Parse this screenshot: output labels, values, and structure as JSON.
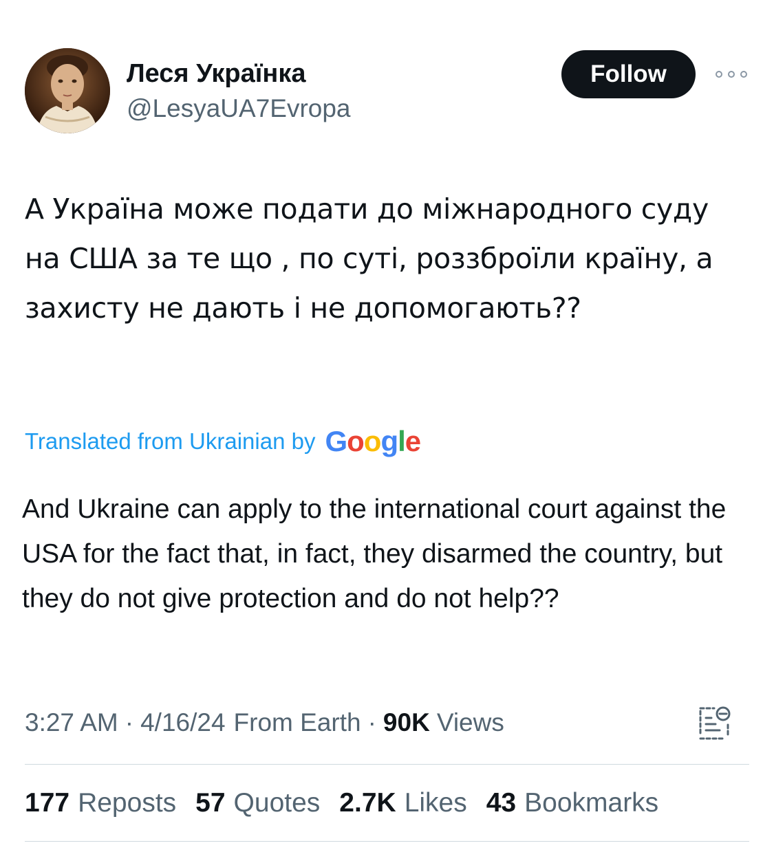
{
  "user": {
    "display_name": "Леся Українка",
    "handle": "@LesyaUA7Evropa",
    "avatar_icon": "portrait-avatar"
  },
  "header": {
    "follow_label": "Follow",
    "more_icon": "more-horizontal-icon"
  },
  "tweet": {
    "text": "А Україна може подати до міжнародного суду на США за те що , по суті, роззброїли країну, а захисту не дають і не допомогають??"
  },
  "translation": {
    "label": "Translated from Ukrainian by",
    "provider_letters": [
      "G",
      "o",
      "o",
      "g",
      "l",
      "e"
    ],
    "provider_colors": [
      "#4285F4",
      "#EA4335",
      "#FBBC05",
      "#4285F4",
      "#34A853",
      "#EA4335"
    ],
    "text": "And Ukraine can apply to the international court against the USA for the fact that, in fact, they disarmed the country, but they do not give protection and do not help??"
  },
  "meta": {
    "time": "3:27 AM",
    "date": "4/16/24",
    "source": "From Earth",
    "views_count": "90K",
    "views_label": "Views",
    "separator": "·",
    "analytics_icon": "analytics-icon"
  },
  "stats": [
    {
      "count": "177",
      "label": "Reposts"
    },
    {
      "count": "57",
      "label": "Quotes"
    },
    {
      "count": "2.7K",
      "label": "Likes"
    },
    {
      "count": "43",
      "label": "Bookmarks"
    }
  ],
  "colors": {
    "accent": "#1d9bf0",
    "text_primary": "#0f1419",
    "text_secondary": "#536471",
    "button_bg": "#0f1419"
  }
}
